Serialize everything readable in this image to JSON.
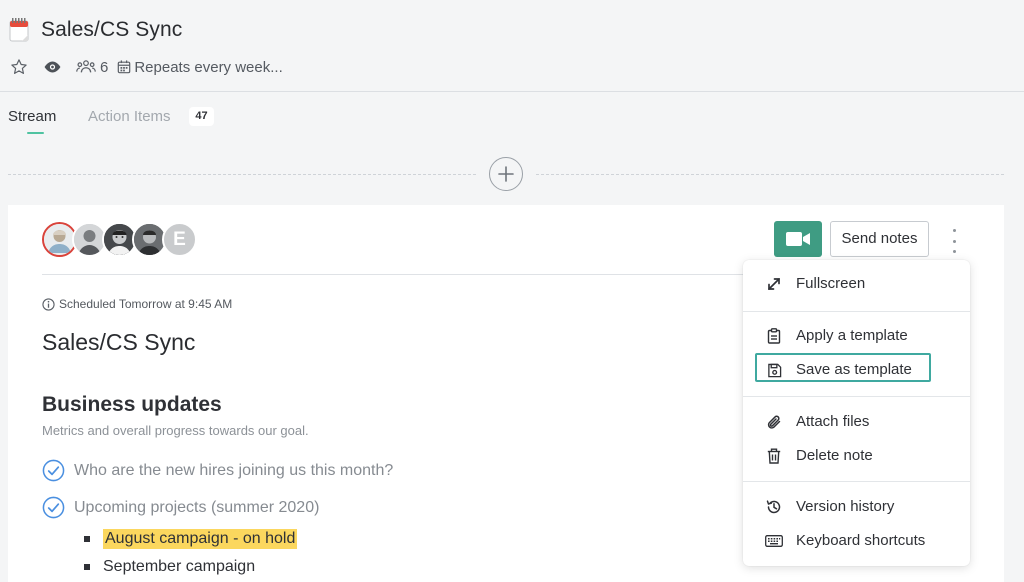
{
  "header": {
    "title": "Sales/CS Sync",
    "attendee_count": "6",
    "recurrence": "Repeats every week..."
  },
  "tabs": [
    {
      "label": "Stream",
      "active": true
    },
    {
      "label": "Action Items",
      "badge": "47"
    }
  ],
  "card": {
    "avatars": [
      {
        "initial": ""
      },
      {
        "initial": ""
      },
      {
        "initial": ""
      },
      {
        "initial": ""
      },
      {
        "initial": "E"
      }
    ],
    "send_notes_label": "Send notes",
    "scheduled": "Scheduled Tomorrow at 9:45 AM",
    "doc_title": "Sales/CS Sync",
    "section_title": "Business updates",
    "section_subtitle": "Metrics and overall progress towards our goal.",
    "todos": [
      "Who are the new hires joining us this month?",
      "Upcoming projects (summer 2020)"
    ],
    "bullets": [
      "August campaign - on hold",
      "September campaign"
    ]
  },
  "menu": {
    "items": [
      {
        "label": "Fullscreen",
        "icon": "expand-icon"
      },
      {
        "label": "Apply a template",
        "icon": "clipboard-icon"
      },
      {
        "label": "Save as template",
        "icon": "save-icon",
        "focused": true
      },
      {
        "label": "Attach files",
        "icon": "paperclip-icon"
      },
      {
        "label": "Delete note",
        "icon": "trash-icon"
      },
      {
        "label": "Version history",
        "icon": "history-icon"
      },
      {
        "label": "Keyboard shortcuts",
        "icon": "keyboard-icon"
      }
    ]
  },
  "colors": {
    "accent": "#4fc3a1",
    "video_button": "#3f9c83",
    "highlight": "#fbd75e",
    "focus_border": "#3fa9a0",
    "check": "#4a8fe0"
  }
}
